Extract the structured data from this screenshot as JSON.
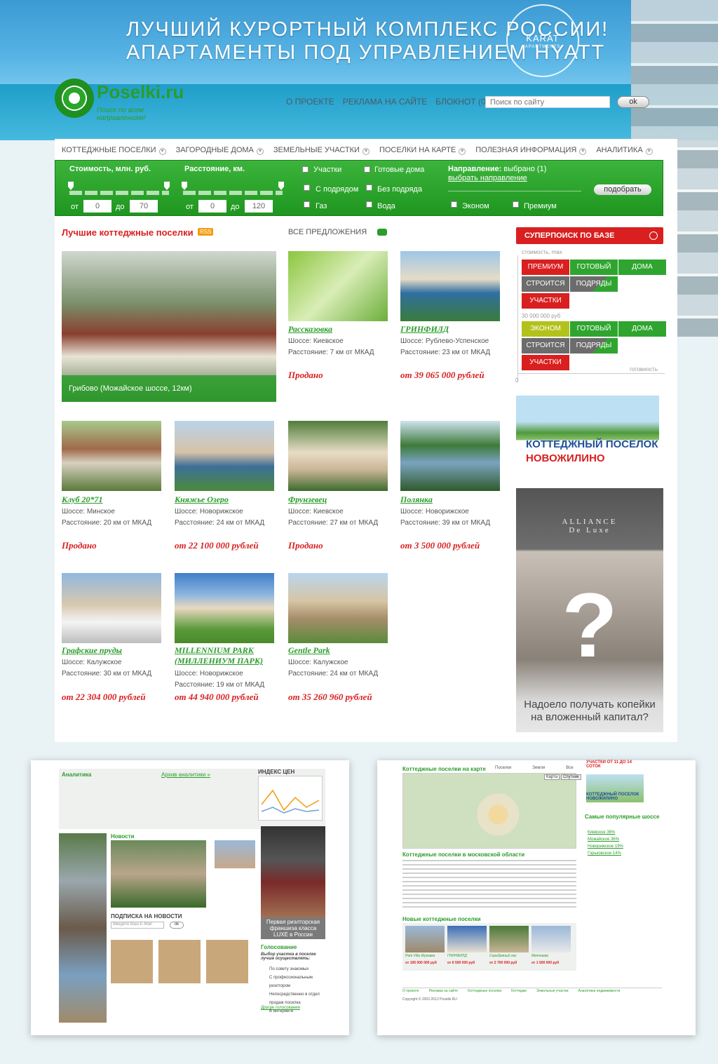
{
  "banner": {
    "line1": "Лучший курортный комплекс России!",
    "line2": "Апартаменты под управлением HYATT",
    "karat_name": "KARAT",
    "karat_sub": "APARTMENTS"
  },
  "logo": {
    "name": "Poselki.ru",
    "tagline": "Поиск по всем направлениям!"
  },
  "topnav": [
    "О ПРОЕКТЕ",
    "РЕКЛАМА НА САЙТЕ",
    "БЛОКНОТ (0)"
  ],
  "search": {
    "placeholder": "Поиск по сайту",
    "button": "ok"
  },
  "catnav": [
    "КОТТЕДЖНЫЕ ПОСЕЛКИ",
    "ЗАГОРОДНЫЕ ДОМА",
    "ЗЕМЕЛЬНЫЕ УЧАСТКИ",
    "ПОСЕЛКИ НА КАРТЕ",
    "ПОЛЕЗНАЯ ИНФОРМАЦИЯ",
    "АНАЛИТИКА"
  ],
  "filter": {
    "price_label": "Стоимость, млн. руб.",
    "distance_label": "Расстояние, км.",
    "from": "от",
    "to": "до",
    "price_from": "0",
    "price_to": "70",
    "dist_from": "0",
    "dist_to": "120",
    "checks": [
      "Участки",
      "Готовые дома",
      "С подрядом",
      "Без подряда",
      "Газ",
      "Вода"
    ],
    "direction_label": "Направление:",
    "direction_value": "выбрано (1)",
    "direction_link": "выбрать направление",
    "class_checks": [
      "Эконом",
      "Премиум"
    ],
    "submit": "подобрать"
  },
  "listing": {
    "title": "Лучшие коттеджные поселки",
    "rss": "RSS",
    "all_offers": "ВСЕ ПРЕДЛОЖЕНИЯ",
    "featured_caption": "Грибово (Можайское шоссе, 12км)",
    "villages": [
      {
        "name": "Рассказовка",
        "highway": "Шоссе: Киевское",
        "distance": "Расстояние: 7 км от МКАД",
        "price": "Продано"
      },
      {
        "name": "ГРИНФИЛД",
        "highway": "Шоссе: Рублево-Успенское",
        "distance": "Расстояние: 23 км от МКАД",
        "price": "от 39 065 000 рублей"
      },
      {
        "name": "Клуб 20*71",
        "highway": "Шоссе: Минское",
        "distance": "Расстояние: 20 км от МКАД",
        "price": "Продано"
      },
      {
        "name": "Княжье Озеро",
        "highway": "Шоссе: Новорижское",
        "distance": "Расстояние: 24 км от МКАД",
        "price": "от 22 100 000 рублей"
      },
      {
        "name": "Фрунзевец",
        "highway": "Шоссе: Киевское",
        "distance": "Расстояние: 27 км от МКАД",
        "price": "Продано"
      },
      {
        "name": "Полянка",
        "highway": "Шоссе: Новорижское",
        "distance": "Расстояние: 39 км от МКАД",
        "price": "от 3 500 000 рублей"
      },
      {
        "name": "Графские пруды",
        "highway": "Шоссе: Калужское",
        "distance": "Расстояние: 30 км от МКАД",
        "price": "от 22 304 000 рублей"
      },
      {
        "name": "MILLENNIUM PARK (МИЛЛЕНИУМ ПАРК)",
        "highway": "Шоссе: Новорижское",
        "distance": "Расстояние: 19 км от МКАД",
        "price": "от 44 940 000 рублей"
      },
      {
        "name": "Gentle Park",
        "highway": "Шоссе: Калужское",
        "distance": "Расстояние: 24 км от МКАД",
        "price": "от 35 260 960 рублей"
      }
    ]
  },
  "superpoisk": {
    "title": "СУПЕРПОИСК ПО БАЗЕ",
    "label_max": "стоимость, max",
    "label_mid": "30 000 000 руб",
    "label_zero": "0",
    "label_ready": "готовность",
    "row1": [
      "ПРЕМИУМ",
      "ГОТОВЫЙ",
      "ДОМА",
      "СТРОИТСЯ",
      "ПОДРЯДЫ",
      "УЧАСТКИ"
    ],
    "row2": [
      "ЭКОНОМ",
      "ГОТОВЫЙ",
      "ДОМА",
      "СТРОИТСЯ",
      "ПОДРЯДЫ",
      "УЧАСТКИ"
    ]
  },
  "ads": {
    "ad1_line1": "КОТТЕДЖНЫЙ ПОСЕЛОК",
    "ad1_line2": "НОВОЖИЛИНО",
    "ad2_brand1": "ALLIANCE",
    "ad2_brand2": "De Luxe",
    "ad2_line1": "Надоело получать копейки",
    "ad2_line2": "на вложенный капитал?"
  },
  "preview_left": {
    "analytics": "Аналитика",
    "archive": "Архив аналитики »",
    "prices": "ИНДЕКС ЦЕН",
    "news": "Новости",
    "subscribe": "ПОДПИСКА НА НОВОСТИ",
    "subscribe_placeholder": "Введите Ваш E-Mail",
    "ok": "ok",
    "vote": "Голосование",
    "question": "Выбор участка в поселке лучше осуществлять:",
    "options": [
      "По совету знакомых",
      "С профессиональным риэлтором",
      "Непосредственно в отдел продаж поселка",
      "В интернете"
    ],
    "other": "Другие голосования",
    "luxe": "Первая риэлторская франшиза класса LUXE в России"
  },
  "preview_right": {
    "map_title": "Коттеджные поселки на карте",
    "legend": [
      "Поселки",
      "Земли",
      "Все"
    ],
    "map_tabs": [
      "Карта",
      "Спутник"
    ],
    "about_title": "Коттеджные поселки в московской области",
    "new_title": "Новые коттеджные поселки",
    "new": [
      {
        "name": "Park Villa Жуковка",
        "price": "от 195 000 000 руб"
      },
      {
        "name": "ГРИНФИЛД",
        "price": "от 6 500 000 руб"
      },
      {
        "name": "Серебряный лес",
        "price": "от 2 700 000 руб"
      },
      {
        "name": "Мечтаево",
        "price": "от 1 500 000 руб"
      }
    ],
    "popular": "Самые популярные шоссе",
    "highways": [
      "Киевское 36%",
      "Можайское 36%",
      "Новорижское 19%",
      "Горьковское 14%"
    ],
    "footer": [
      "О проекте",
      "Реклама на сайте",
      "Коттеджные поселки",
      "Коттеджи",
      "Земельные участки",
      "Аналитика недвижимости"
    ],
    "copyright": "Copyright © 2002-2012 Poselki.RU",
    "ad_title": "КОТТЕДЖНЫЙ ПОСЕЛОК НОВОЖИЛИНО",
    "ad_top": "УЧАСТКИ ОТ 11 ДО 14 СОТОК"
  },
  "colors": {
    "green": "#2a9d2a",
    "red": "#d91f1f",
    "sky": "#4aa8dc",
    "gray": "#6c6c6c"
  }
}
